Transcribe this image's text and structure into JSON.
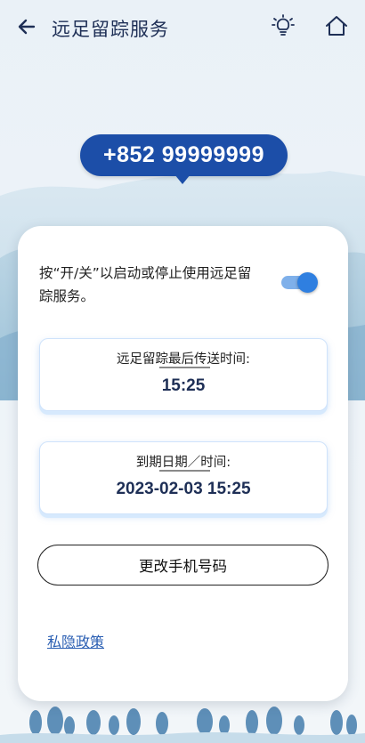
{
  "header": {
    "title": "远足留踪服务",
    "back_icon": "arrow-left-icon",
    "bulb_icon": "lightbulb-icon",
    "home_icon": "home-icon"
  },
  "phone_number": "+852 99999999",
  "card": {
    "instruction": "按“开/关”以启动或停止使用远足留踪服务。",
    "toggle_on": true,
    "last_sent": {
      "label": "远足留踪最后传送时间:",
      "value": "15:25"
    },
    "expiry": {
      "label": "到期日期／时间:",
      "value": "2023-02-03 15:25"
    },
    "change_button": "更改手机号码",
    "privacy_link": "私隐政策"
  },
  "colors": {
    "primary": "#1c4ea8",
    "toggle_thumb": "#2f7fe0",
    "toggle_track": "#7fb0ea",
    "link": "#2b5fb3",
    "mountain": "#a9c9dc"
  }
}
